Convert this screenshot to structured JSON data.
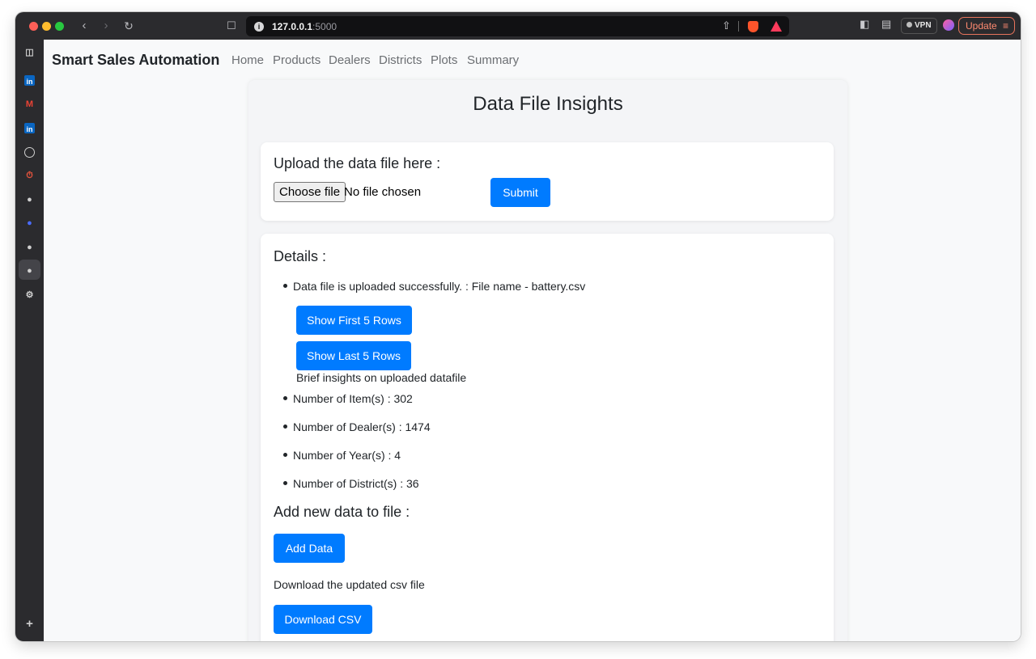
{
  "browser": {
    "url_host": "127.0.0.1",
    "url_port": ":5000",
    "vpn_label": "VPN",
    "update_label": "Update"
  },
  "nav": {
    "brand": "Smart Sales Automation",
    "links": [
      "Home",
      "Products",
      "Dealers",
      "Districts",
      "Plots",
      "Summary"
    ]
  },
  "page": {
    "title": "Data File Insights"
  },
  "upload": {
    "heading": "Upload the data file here :",
    "choose_file_label": "Choose file",
    "file_status": "No file chosen",
    "submit_label": "Submit"
  },
  "details": {
    "heading": "Details :",
    "upload_message": "Data file is uploaded successfully. : File name - battery.csv",
    "show_first_label": "Show First 5 Rows",
    "show_last_label": "Show Last 5 Rows",
    "insights_caption": "Brief insights on uploaded datafile",
    "stats": [
      "Number of Item(s) : 302",
      "Number of Dealer(s) : 1474",
      "Number of Year(s) : 4",
      "Number of District(s) : 36"
    ],
    "add_heading": "Add new data to file :",
    "add_label": "Add Data",
    "download_caption": "Download the updated csv file",
    "download_label": "Download CSV"
  }
}
